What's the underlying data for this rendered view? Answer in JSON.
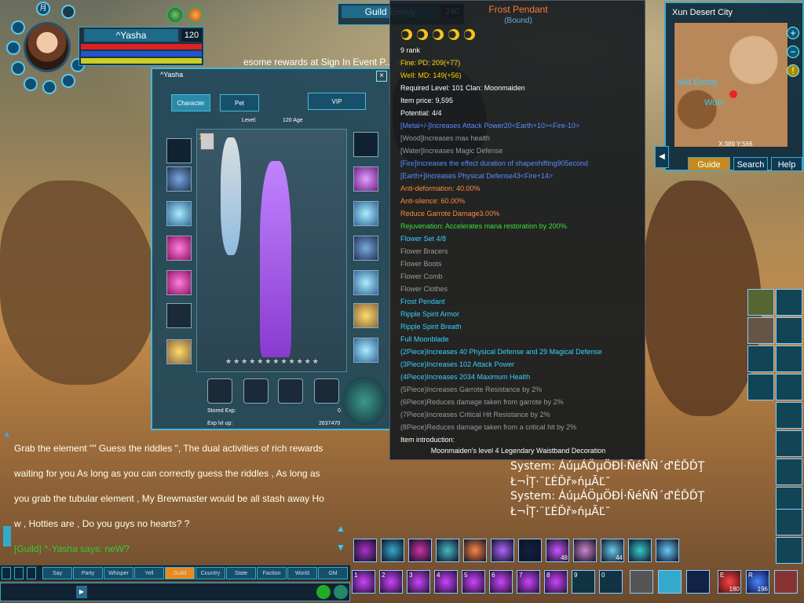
{
  "player": {
    "name": "^Yasha",
    "level": "120",
    "portrait_glyphs": [
      "月",
      "神"
    ]
  },
  "target": {
    "name": "Guild Envoy",
    "level": "240"
  },
  "announcement": "esome rewards at Sign In Event P... andom gifts whi...",
  "minimap": {
    "location": "Xun Desert City",
    "labels": [
      "uild Envoy",
      "Wuin"
    ],
    "coords": "X:389 Y:566",
    "buttons": {
      "guide": "Guide",
      "search": "Search",
      "help": "Help"
    }
  },
  "character_window": {
    "title": "^Yasha",
    "tabs": {
      "character": "Character",
      "pet": "Pet",
      "vip": "VIP"
    },
    "level_label": "Level:",
    "age": "120 Age",
    "stored_exp_label": "Stored Exp:",
    "stored_exp": "0",
    "exp_lvl_label": "Exp lvl up:",
    "exp_lvl": "2637470",
    "slot_one": "1"
  },
  "tooltip": {
    "name": "Frost Pendant",
    "bound": "(Bound)",
    "stars": 5,
    "rank": "9 rank",
    "lines": [
      {
        "t": "Fine:  PD: 209(+77)",
        "c": "#ffd400"
      },
      {
        "t": "Well:  MD: 149(+56)",
        "c": "#ffd400"
      },
      {
        "t": "Required Level: 101     Clan:  Moonmaiden",
        "c": "#ffffff"
      },
      {
        "t": "Item price: 9,595",
        "c": "#ffffff"
      },
      {
        "t": "Potential: 4/4",
        "c": "#ffffff"
      },
      {
        "t": "[Metal+/-]Increases Attack Power20<Earth+10><Fire-10>",
        "c": "#5a8cff"
      },
      {
        "t": "[Wood]Increases max health",
        "c": "#9a9a9a"
      },
      {
        "t": "[Water]Increases Magic Defense",
        "c": "#9a9a9a"
      },
      {
        "t": "[Fire]Increases the effect duration of shapeshifting905econd",
        "c": "#5a8cff"
      },
      {
        "t": "[Earth+]Increases Physical Defense43<Fire+14>",
        "c": "#5a8cff"
      },
      {
        "t": "Anti-deformation: 40.00%",
        "c": "#ff8a3a"
      },
      {
        "t": "Anti-silence: 60.00%",
        "c": "#ff8a3a"
      },
      {
        "t": "Reduce Garrote Damage3.00%",
        "c": "#ff8a3a"
      },
      {
        "t": "Rejuvenation: Accelerates mana restoration by 200%.",
        "c": "#3ae03a"
      },
      {
        "t": "Flower Set 4/8",
        "c": "#3ad0ff"
      },
      {
        "t": "Flower Bracers",
        "c": "#9a9a9a"
      },
      {
        "t": "Flower Boots",
        "c": "#9a9a9a"
      },
      {
        "t": "Flower Comb",
        "c": "#9a9a9a"
      },
      {
        "t": "Flower Clothes",
        "c": "#9a9a9a"
      },
      {
        "t": "Frost Pendant",
        "c": "#3ad0ff"
      },
      {
        "t": "Ripple Spirit Armor",
        "c": "#3ad0ff"
      },
      {
        "t": "Ripple Spirit Breath",
        "c": "#3ad0ff"
      },
      {
        "t": "Full Moonblade",
        "c": "#3ad0ff"
      },
      {
        "t": "(2Piece)Increases 40 Physical Defense and 29 Magical Defense",
        "c": "#3ad0ff"
      },
      {
        "t": "(3Piece)Increases 102 Attack Power",
        "c": "#3ad0ff"
      },
      {
        "t": "(4Piece)Increases 2034 Maximum Health",
        "c": "#3ad0ff"
      },
      {
        "t": "(5Piece)Increases Garrote Resistance by 2%",
        "c": "#9a9a9a"
      },
      {
        "t": "(6Piece)Reduces damage taken from garrote by 2%",
        "c": "#9a9a9a"
      },
      {
        "t": "(7Piece)Increases Critical Hit Resistance by 2%",
        "c": "#9a9a9a"
      },
      {
        "t": "(8Piece)Reduces damage taken from a critical hit by 2%",
        "c": "#9a9a9a"
      },
      {
        "t": "Item introduction:",
        "c": "#ffffff"
      }
    ],
    "introduction": "Moonmaiden's level 4 Legendary Waistband Decoration"
  },
  "chat": {
    "lines": [
      "Grab the element \"\" Guess the riddles \", The dual activities of rich rewards",
      "waiting for you  As long as you can correctly guess the riddles , As long as",
      "you grab the tubular element , My Brewmaster would be all stash away  Ho",
      "w , Hotties are , Do you guys no hearts? ?"
    ],
    "guild_line": "[Guild] ^-Yasha says: neW?",
    "tabs": [
      "Say",
      "Party",
      "Whisper",
      "Yell",
      "Guild",
      "Country",
      "State",
      "Faction",
      "World",
      "GM"
    ]
  },
  "system_messages": [
    {
      "a": "System: ÁúµÁÖµÖÐÍ·ÑéÑÑ´ď'ÉĎĎŢ",
      "b": "Ł¬ÎŢ·¨ĽÉĎř»ńµÃĽ˘"
    },
    {
      "a": "System: ÁúµÁÖµÖÐÍ·ÑéÑÑ´ď'ÉĎĎŢ",
      "b": "Ł¬ÎŢ·¨ĽÉĎř»ńµÃĽ˘"
    }
  ],
  "skillbar_top": {
    "badges": [
      "48",
      "44"
    ]
  },
  "skillbar_bottom": {
    "keys": [
      "1",
      "2",
      "3",
      "4",
      "5",
      "6",
      "7",
      "8",
      "9",
      "0"
    ],
    "extra_keys": [
      {
        "key": "E",
        "count": "180"
      },
      {
        "key": "R",
        "count": "196"
      }
    ]
  },
  "colors": {
    "accent": "#3fa8cc",
    "tooltip_title": "#ff7a3a",
    "gold": "#f5c518"
  }
}
